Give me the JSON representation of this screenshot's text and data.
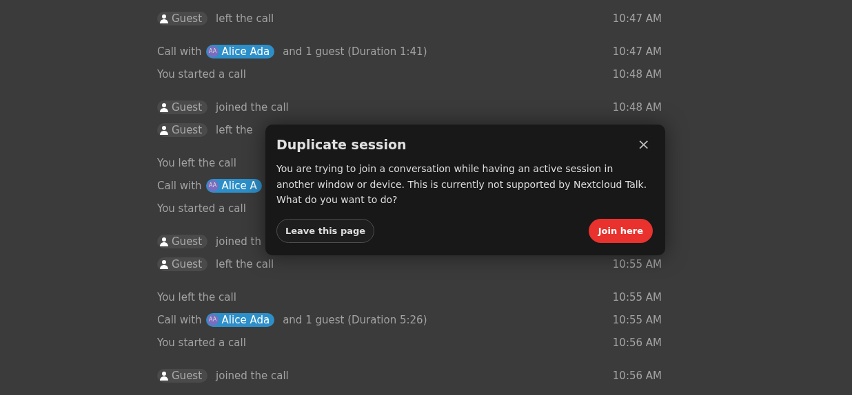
{
  "timeline": [
    {
      "messages": [
        {
          "kind": "guest",
          "actor": "Guest",
          "text": "left the call",
          "time": "10:47 AM"
        }
      ]
    },
    {
      "messages": [
        {
          "kind": "call_summary",
          "lead": "Call with",
          "actor": "Alice Ada",
          "avatar": "AA",
          "text": "and 1 guest (Duration 1:41)",
          "time": "10:47 AM"
        },
        {
          "kind": "plain",
          "text": "You started a call",
          "time": "10:48 AM"
        }
      ]
    },
    {
      "messages": [
        {
          "kind": "guest",
          "actor": "Guest",
          "text": "joined the call",
          "time": "10:48 AM"
        },
        {
          "kind": "guest",
          "actor": "Guest",
          "text": "left the"
        }
      ]
    },
    {
      "messages": [
        {
          "kind": "plain",
          "text": "You left the call"
        },
        {
          "kind": "call_summary",
          "lead": "Call with",
          "actor": "Alice A",
          "avatar": "AA"
        },
        {
          "kind": "plain",
          "text": "You started a call"
        }
      ]
    },
    {
      "messages": [
        {
          "kind": "guest",
          "actor": "Guest",
          "text": "joined th"
        },
        {
          "kind": "guest",
          "actor": "Guest",
          "text": "left the call",
          "time": "10:55 AM"
        }
      ]
    },
    {
      "messages": [
        {
          "kind": "plain",
          "text": "You left the call",
          "time": "10:55 AM"
        },
        {
          "kind": "call_summary",
          "lead": "Call with",
          "actor": "Alice Ada",
          "avatar": "AA",
          "text": "and 1 guest (Duration 5:26)",
          "time": "10:55 AM"
        },
        {
          "kind": "plain",
          "text": "You started a call",
          "time": "10:56 AM"
        }
      ]
    },
    {
      "messages": [
        {
          "kind": "guest",
          "actor": "Guest",
          "text": "joined the call",
          "time": "10:56 AM"
        }
      ]
    }
  ],
  "dialog": {
    "title": "Duplicate session",
    "close": "×",
    "body": "You are trying to join a conversation while having an active session in another window or device. This is currently not supported by Nextcloud Talk. What do you want to do?",
    "buttons": [
      {
        "kind": "secondary",
        "label": "Leave this page"
      },
      {
        "kind": "primary",
        "label": "Join here"
      }
    ]
  }
}
